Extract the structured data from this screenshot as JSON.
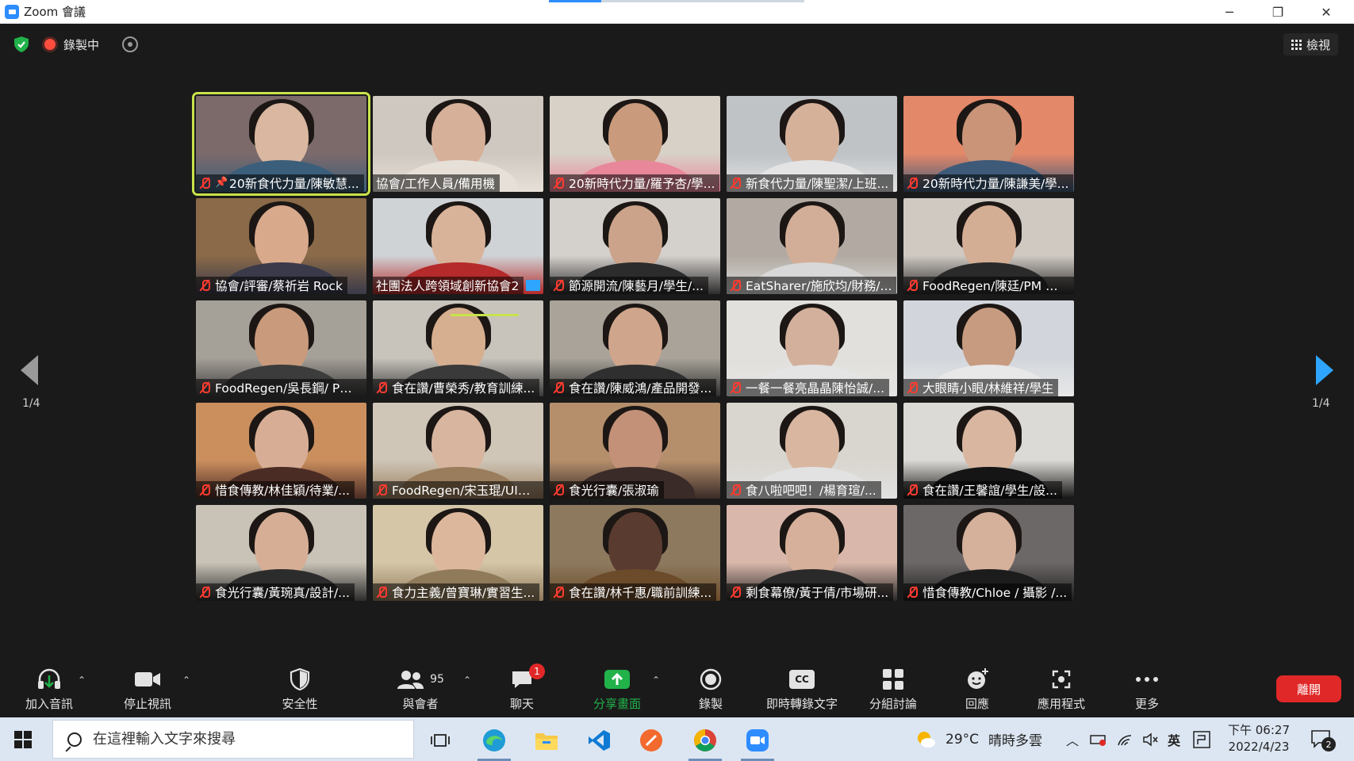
{
  "window": {
    "title": "Zoom 會議",
    "minimize": "─",
    "restore": "❐",
    "close": "✕"
  },
  "topbar": {
    "recording_label": "錄製中",
    "view_label": "檢視"
  },
  "pagination": {
    "left_page": "1/4",
    "right_page": "1/4"
  },
  "participants": [
    {
      "name": "20新食代力量/陳敏慧...",
      "pinned": true,
      "active": true
    },
    {
      "name": "協會/工作人員/備用機",
      "muted": false
    },
    {
      "name": "20新時代力量/羅予杏/學..."
    },
    {
      "name": "新食代力量/陳聖潔/上班..."
    },
    {
      "name": "20新時代力量/陳謙美/學..."
    },
    {
      "name": "協會/評審/蔡祈岩 Rock"
    },
    {
      "name": "社團法人跨領域創新協會2",
      "muted": false,
      "speaking": true
    },
    {
      "name": "節源開流/陳藝月/學生/..."
    },
    {
      "name": "EatSharer/施欣均/財務/..."
    },
    {
      "name": "FoodRegen/陳廷/PM 自..."
    },
    {
      "name": "FoodRegen/吳長鋼/ PM ..."
    },
    {
      "name": "食在讚/曹榮秀/教育訓練..."
    },
    {
      "name": "食在讚/陳威鴻/產品開發..."
    },
    {
      "name": "一餐一餐亮晶晶陳怡誠/..."
    },
    {
      "name": "大眼睛小眼/林維祥/學生"
    },
    {
      "name": "惜食傳教/林佳穎/待業/..."
    },
    {
      "name": "FoodRegen/宋玉琨/UIUX..."
    },
    {
      "name": "食光行囊/張淑瑜"
    },
    {
      "name": "食八啦吧吧！/楊育瑄/..."
    },
    {
      "name": "食在讚/王馨誼/學生/設..."
    },
    {
      "name": "食光行囊/黃琬真/設計/..."
    },
    {
      "name": "食力主義/曾寶琳/實習生..."
    },
    {
      "name": "食在讚/林千惠/職前訓練..."
    },
    {
      "name": "剩食幕僚/黃于倩/市場研..."
    },
    {
      "name": "惜食傳教/Chloe / 攝影 /..."
    }
  ],
  "toolbar": {
    "audio": "加入音訊",
    "video": "停止視訊",
    "security": "安全性",
    "participants": "與會者",
    "participants_count": "95",
    "chat": "聊天",
    "chat_badge": "1",
    "share": "分享畫面",
    "record": "錄製",
    "captions": "即時轉錄文字",
    "captions_icon": "CC",
    "breakout": "分組討論",
    "reactions": "回應",
    "apps": "應用程式",
    "more": "更多",
    "leave": "離開"
  },
  "taskbar": {
    "search_placeholder": "在這裡輸入文字來搜尋",
    "weather_temp": "29°C",
    "weather_text": "晴時多雲",
    "ime": "英",
    "time": "下午 06:27",
    "date": "2022/4/23",
    "notif_count": "2"
  },
  "colors": {
    "accent_blue": "#2d8cff",
    "active_outline": "#c7e34b",
    "mute_red": "#ff3b30",
    "leave_red": "#e02828",
    "share_green": "#21b24a"
  }
}
